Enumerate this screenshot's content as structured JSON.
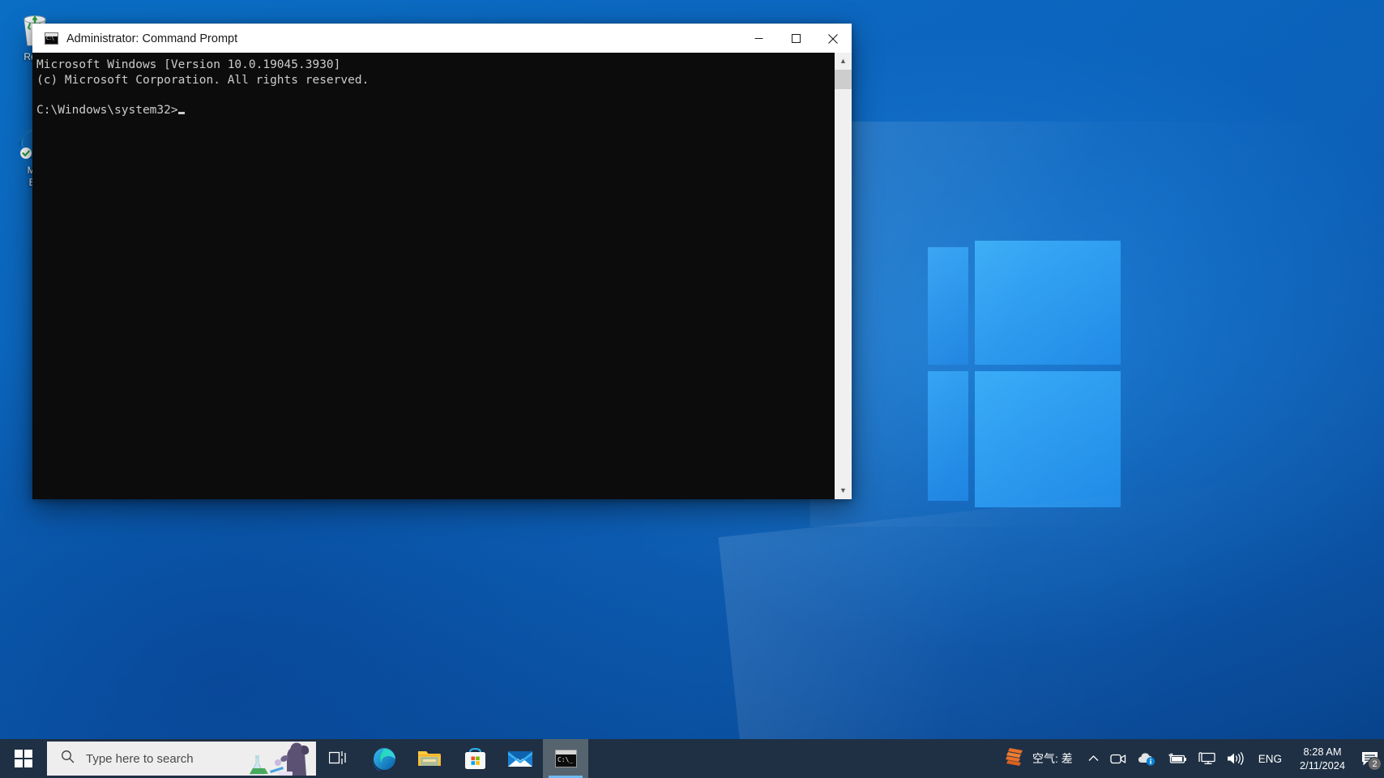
{
  "desktop": {
    "icons": [
      {
        "label": "Recy",
        "name": "recycle-bin"
      },
      {
        "label": "Mic\nEd",
        "name": "microsoft-edge"
      }
    ]
  },
  "window": {
    "title": "Administrator: Command Prompt",
    "icon": "command-prompt-icon",
    "controls": {
      "minimize": "Minimize",
      "maximize": "Maximize",
      "close": "Close"
    },
    "console": {
      "line1": "Microsoft Windows [Version 10.0.19045.3930]",
      "line2": "(c) Microsoft Corporation. All rights reserved.",
      "line3": "",
      "prompt": "C:\\Windows\\system32>"
    }
  },
  "taskbar": {
    "start": "Start",
    "search": {
      "placeholder": "Type here to search"
    },
    "items": [
      {
        "name": "task-view",
        "label": "Task View"
      },
      {
        "name": "microsoft-edge",
        "label": "Microsoft Edge"
      },
      {
        "name": "file-explorer",
        "label": "File Explorer"
      },
      {
        "name": "microsoft-store",
        "label": "Microsoft Store"
      },
      {
        "name": "mail",
        "label": "Mail"
      },
      {
        "name": "command-prompt",
        "label": "Administrator: Command Prompt"
      }
    ],
    "weather": {
      "text": "空气: 差"
    },
    "tray": [
      {
        "name": "show-hidden-icons",
        "label": "Show hidden icons"
      },
      {
        "name": "meet-now",
        "label": "Meet Now"
      },
      {
        "name": "onedrive",
        "label": "OneDrive"
      },
      {
        "name": "battery",
        "label": "Battery"
      },
      {
        "name": "network",
        "label": "Network"
      },
      {
        "name": "volume",
        "label": "Volume"
      }
    ],
    "language": "ENG",
    "clock": {
      "time": "8:28 AM",
      "date": "2/11/2024"
    },
    "notifications": {
      "count": "2"
    }
  },
  "colors": {
    "taskbar": "#1f3044",
    "console_bg": "#0c0c0c",
    "console_fg": "#cccccc",
    "accent": "#0a6ec4",
    "badge": "#6b6b6b"
  }
}
